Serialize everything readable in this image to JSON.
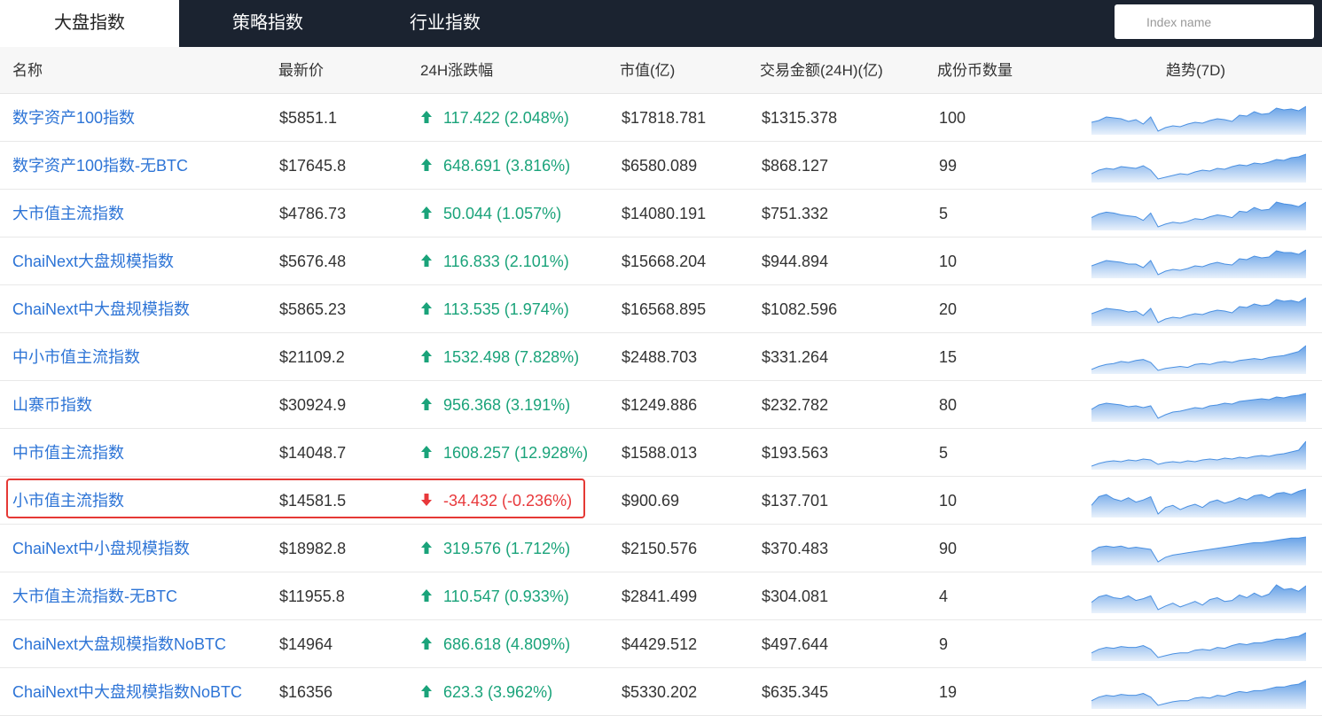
{
  "tabs": [
    "大盘指数",
    "策略指数",
    "行业指数"
  ],
  "search": {
    "placeholder": "Index name"
  },
  "headers": {
    "name": "名称",
    "price": "最新价",
    "change": "24H涨跌幅",
    "market_cap": "市值(亿)",
    "volume": "交易金额(24H)(亿)",
    "constituents": "成份币数量",
    "trend": "趋势(7D)"
  },
  "colors": {
    "up": "#1aa37a",
    "down": "#e8383b",
    "link": "#2d74d6",
    "tabbar": "#1b2330",
    "spark": "#4a90e2"
  },
  "rows": [
    {
      "name": "数字资产100指数",
      "price": "$5851.1",
      "change": "117.422 (2.048%)",
      "dir": "up",
      "market_cap": "$17818.781",
      "volume": "$1315.378",
      "count": "100",
      "trend": [
        40,
        42,
        46,
        45,
        44,
        41,
        43,
        38,
        46,
        30,
        34,
        36,
        35,
        38,
        40,
        39,
        42,
        44,
        43,
        41,
        48,
        47,
        52,
        49,
        50,
        56,
        54,
        55,
        53,
        58
      ]
    },
    {
      "name": "数字资产100指数-无BTC",
      "price": "$17645.8",
      "change": "648.691 (3.816%)",
      "dir": "up",
      "market_cap": "$6580.089",
      "volume": "$868.127",
      "count": "99",
      "trend": [
        36,
        40,
        42,
        41,
        44,
        43,
        42,
        45,
        40,
        30,
        32,
        34,
        36,
        35,
        38,
        40,
        39,
        42,
        41,
        44,
        46,
        45,
        48,
        47,
        49,
        52,
        51,
        54,
        55,
        58
      ]
    },
    {
      "name": "大市值主流指数",
      "price": "$4786.73",
      "change": "50.044 (1.057%)",
      "dir": "up",
      "market_cap": "$14080.191",
      "volume": "$751.332",
      "count": "5",
      "trend": [
        40,
        44,
        46,
        45,
        43,
        42,
        41,
        37,
        45,
        30,
        33,
        35,
        34,
        36,
        39,
        38,
        41,
        43,
        42,
        40,
        47,
        46,
        51,
        48,
        49,
        57,
        55,
        54,
        52,
        57
      ]
    },
    {
      "name": "ChaiNext大盘规模指数",
      "price": "$5676.48",
      "change": "116.833 (2.101%)",
      "dir": "up",
      "market_cap": "$15668.204",
      "volume": "$944.894",
      "count": "10",
      "trend": [
        40,
        43,
        46,
        45,
        44,
        42,
        42,
        38,
        46,
        30,
        34,
        36,
        35,
        37,
        40,
        39,
        42,
        44,
        42,
        41,
        48,
        47,
        51,
        49,
        50,
        57,
        55,
        55,
        53,
        58
      ]
    },
    {
      "name": "ChaiNext中大盘规模指数",
      "price": "$5865.23",
      "change": "113.535 (1.974%)",
      "dir": "up",
      "market_cap": "$16568.895",
      "volume": "$1082.596",
      "count": "20",
      "trend": [
        40,
        43,
        46,
        45,
        44,
        42,
        43,
        38,
        46,
        30,
        34,
        36,
        35,
        38,
        40,
        39,
        42,
        44,
        43,
        41,
        48,
        47,
        51,
        49,
        50,
        56,
        54,
        55,
        53,
        58
      ]
    },
    {
      "name": "中小市值主流指数",
      "price": "$21109.2",
      "change": "1532.498 (7.828%)",
      "dir": "up",
      "market_cap": "$2488.703",
      "volume": "$331.264",
      "count": "15",
      "trend": [
        34,
        37,
        39,
        40,
        42,
        41,
        43,
        44,
        41,
        33,
        35,
        36,
        37,
        36,
        39,
        40,
        39,
        41,
        42,
        41,
        43,
        44,
        45,
        44,
        46,
        47,
        48,
        50,
        52,
        58
      ]
    },
    {
      "name": "山寨币指数",
      "price": "$30924.9",
      "change": "956.368 (3.191%)",
      "dir": "up",
      "market_cap": "$1249.886",
      "volume": "$232.782",
      "count": "80",
      "trend": [
        40,
        45,
        47,
        46,
        45,
        43,
        44,
        42,
        44,
        30,
        34,
        37,
        38,
        40,
        42,
        41,
        44,
        45,
        47,
        46,
        49,
        50,
        51,
        52,
        51,
        54,
        53,
        55,
        56,
        58
      ]
    },
    {
      "name": "中市值主流指数",
      "price": "$14048.7",
      "change": "1608.257 (12.928%)",
      "dir": "up",
      "market_cap": "$1588.013",
      "volume": "$193.563",
      "count": "5",
      "trend": [
        32,
        35,
        37,
        38,
        37,
        39,
        38,
        40,
        39,
        34,
        36,
        37,
        36,
        38,
        37,
        39,
        40,
        39,
        41,
        40,
        42,
        41,
        43,
        44,
        43,
        45,
        46,
        48,
        50,
        60
      ]
    },
    {
      "name": "小市值主流指数",
      "price": "$14581.5",
      "change": "-34.432 (-0.236%)",
      "dir": "down",
      "market_cap": "$900.69",
      "volume": "$137.701",
      "count": "10",
      "trend": [
        40,
        48,
        50,
        46,
        44,
        47,
        43,
        45,
        48,
        32,
        38,
        40,
        36,
        39,
        41,
        38,
        43,
        45,
        42,
        44,
        47,
        45,
        49,
        50,
        47,
        51,
        52,
        50,
        53,
        55
      ]
    },
    {
      "name": "ChaiNext中小盘规模指数",
      "price": "$18982.8",
      "change": "319.576 (1.712%)",
      "dir": "up",
      "market_cap": "$2150.576",
      "volume": "$370.483",
      "count": "90",
      "trend": [
        42,
        46,
        47,
        46,
        47,
        45,
        46,
        45,
        44,
        33,
        37,
        39,
        40,
        41,
        42,
        43,
        44,
        45,
        46,
        47,
        48,
        49,
        50,
        50,
        51,
        52,
        53,
        54,
        54,
        55
      ]
    },
    {
      "name": "大市值主流指数-无BTC",
      "price": "$11955.8",
      "change": "110.547 (0.933%)",
      "dir": "up",
      "market_cap": "$2841.499",
      "volume": "$304.081",
      "count": "4",
      "trend": [
        38,
        44,
        46,
        43,
        42,
        45,
        40,
        42,
        45,
        30,
        34,
        37,
        33,
        36,
        39,
        35,
        41,
        43,
        39,
        40,
        46,
        43,
        48,
        44,
        47,
        57,
        52,
        53,
        50,
        56
      ]
    },
    {
      "name": "ChaiNext大盘规模指数NoBTC",
      "price": "$14964",
      "change": "686.618 (4.809%)",
      "dir": "up",
      "market_cap": "$4429.512",
      "volume": "$497.644",
      "count": "9",
      "trend": [
        36,
        40,
        42,
        41,
        43,
        42,
        42,
        44,
        40,
        31,
        33,
        35,
        36,
        36,
        39,
        40,
        39,
        42,
        41,
        44,
        46,
        45,
        47,
        47,
        49,
        51,
        51,
        53,
        54,
        58
      ]
    },
    {
      "name": "ChaiNext中大盘规模指数NoBTC",
      "price": "$16356",
      "change": "623.3 (3.962%)",
      "dir": "up",
      "market_cap": "$5330.202",
      "volume": "$635.345",
      "count": "19",
      "trend": [
        36,
        40,
        42,
        41,
        43,
        42,
        42,
        44,
        40,
        31,
        33,
        35,
        36,
        36,
        39,
        40,
        39,
        42,
        41,
        44,
        46,
        45,
        47,
        47,
        49,
        51,
        51,
        53,
        54,
        58
      ]
    }
  ]
}
